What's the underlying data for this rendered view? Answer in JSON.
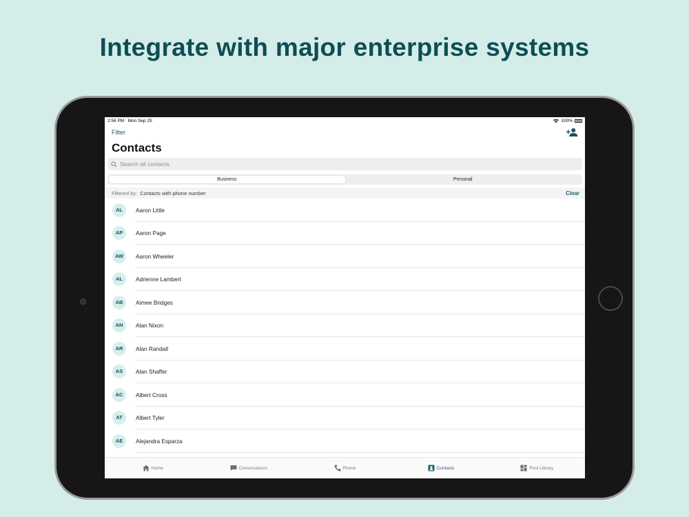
{
  "headline": "Integrate with major enterprise systems",
  "status": {
    "time": "2:56 PM",
    "date": "Mon Sep 25",
    "battery": "100%"
  },
  "nav": {
    "filter_label": "Filter",
    "add_icon": "add-contact-icon"
  },
  "title": "Contacts",
  "search": {
    "placeholder": "Search all contacts"
  },
  "segments": [
    {
      "label": "Business",
      "active": true
    },
    {
      "label": "Personal",
      "active": false
    }
  ],
  "filter_bar": {
    "label": "Filtered by:",
    "value": "Contacts with phone number",
    "clear": "Clear"
  },
  "contacts": [
    {
      "initials": "AL",
      "name": "Aaron Little"
    },
    {
      "initials": "AP",
      "name": "Aaron Page"
    },
    {
      "initials": "AW",
      "name": "Aaron Wheeler"
    },
    {
      "initials": "AL",
      "name": "Adrienne Lambert"
    },
    {
      "initials": "AB",
      "name": "Aimee Bridges"
    },
    {
      "initials": "AN",
      "name": "Alan Nixon"
    },
    {
      "initials": "AR",
      "name": "Alan Randall"
    },
    {
      "initials": "AS",
      "name": "Alan Shaffer"
    },
    {
      "initials": "AC",
      "name": "Albert Cross"
    },
    {
      "initials": "AT",
      "name": "Albert Tyler"
    },
    {
      "initials": "AE",
      "name": "Alejandra Esparza"
    }
  ],
  "tabs": [
    {
      "label": "Home",
      "icon": "home-icon",
      "active": false
    },
    {
      "label": "Conversations",
      "icon": "chat-icon",
      "active": false
    },
    {
      "label": "Phone",
      "icon": "phone-icon",
      "active": false
    },
    {
      "label": "Contacts",
      "icon": "contacts-icon",
      "active": true
    },
    {
      "label": "Post Library",
      "icon": "library-icon",
      "active": false
    }
  ],
  "colors": {
    "background": "#d4ede9",
    "accent": "#1f5d69",
    "headline": "#0f4d55",
    "avatar_bg": "#d6efee"
  }
}
